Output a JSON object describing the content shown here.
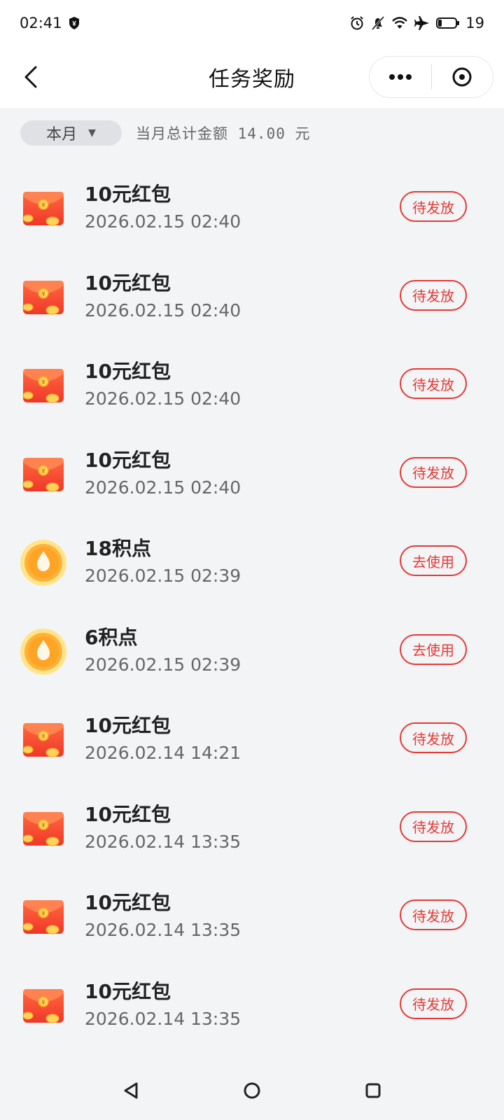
{
  "status_bar": {
    "time": "02:41",
    "battery": "19"
  },
  "header": {
    "title": "任务奖励"
  },
  "filter": {
    "month_label": "本月",
    "total_text": "当月总计金额 14.00 元"
  },
  "items": [
    {
      "type": "red-packet",
      "title_num": "10",
      "title_rest": "元红包",
      "time": "2026.02.15 02:40",
      "action": "待发放"
    },
    {
      "type": "red-packet",
      "title_num": "10",
      "title_rest": "元红包",
      "time": "2026.02.15 02:40",
      "action": "待发放"
    },
    {
      "type": "red-packet",
      "title_num": "10",
      "title_rest": "元红包",
      "time": "2026.02.15 02:40",
      "action": "待发放"
    },
    {
      "type": "red-packet",
      "title_num": "10",
      "title_rest": "元红包",
      "time": "2026.02.15 02:40",
      "action": "待发放"
    },
    {
      "type": "points",
      "title_num": "18",
      "title_rest": "积点",
      "time": "2026.02.15 02:39",
      "action": "去使用"
    },
    {
      "type": "points",
      "title_num": "6",
      "title_rest": "积点",
      "time": "2026.02.15 02:39",
      "action": "去使用"
    },
    {
      "type": "red-packet",
      "title_num": "10",
      "title_rest": "元红包",
      "time": "2026.02.14 14:21",
      "action": "待发放"
    },
    {
      "type": "red-packet",
      "title_num": "10",
      "title_rest": "元红包",
      "time": "2026.02.14 13:35",
      "action": "待发放"
    },
    {
      "type": "red-packet",
      "title_num": "10",
      "title_rest": "元红包",
      "time": "2026.02.14 13:35",
      "action": "待发放"
    },
    {
      "type": "red-packet",
      "title_num": "10",
      "title_rest": "元红包",
      "time": "2026.02.14 13:35",
      "action": "待发放"
    }
  ],
  "colors": {
    "accent_red": "#e53935",
    "background": "#f3f4f6"
  },
  "icons": {
    "red_packet": "red-packet-icon",
    "points": "points-drop-icon"
  }
}
